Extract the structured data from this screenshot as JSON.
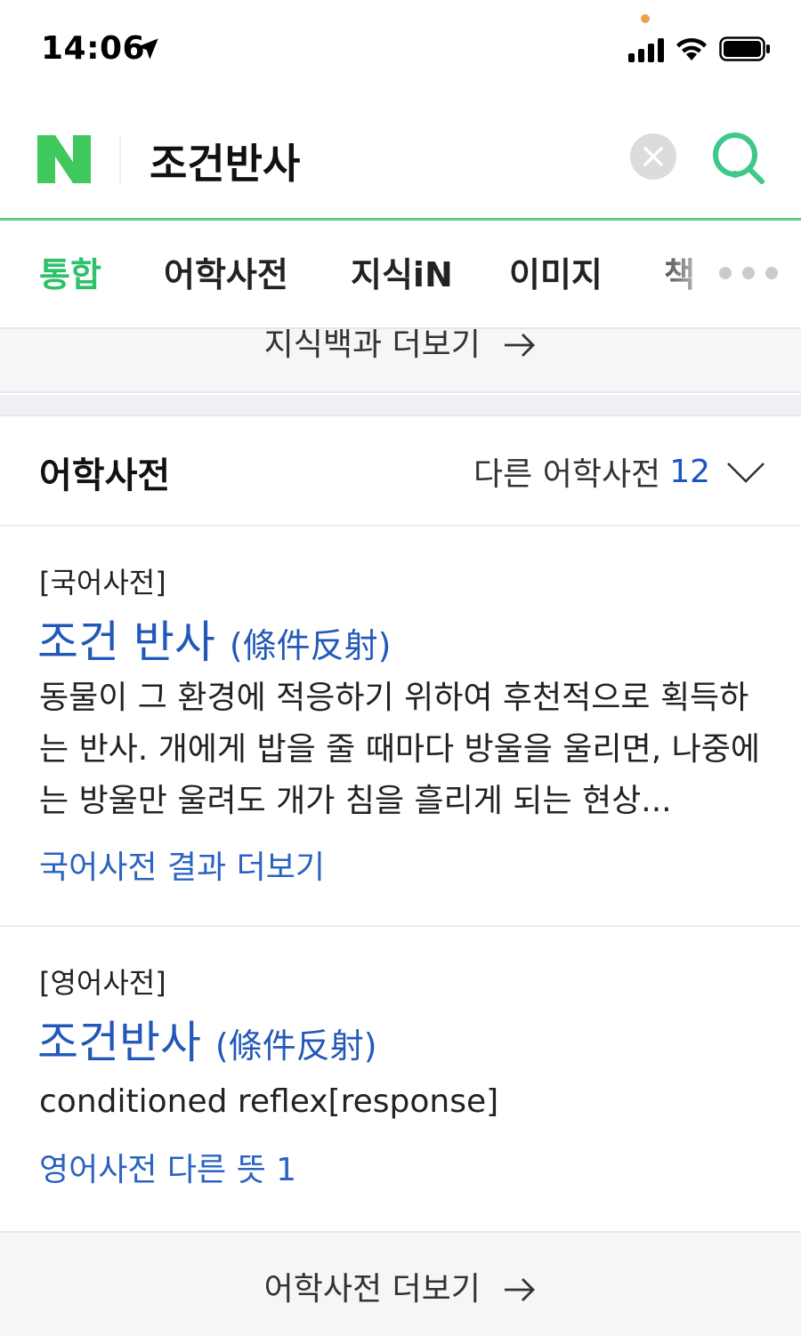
{
  "status_bar": {
    "time": "14:06"
  },
  "search": {
    "query": "조건반사",
    "brand_color": "#03c75a"
  },
  "tabs": [
    {
      "label": "통합",
      "active": true
    },
    {
      "label": "어학사전",
      "active": false
    },
    {
      "label": "지식iN",
      "active": false
    },
    {
      "label": "이미지",
      "active": false
    },
    {
      "label": "책",
      "active": false
    }
  ],
  "prev_section": {
    "more_label": "지식백과 더보기"
  },
  "dictionary": {
    "title": "어학사전",
    "other_label": "다른 어학사전",
    "other_count": "12",
    "entries": [
      {
        "tag": "[국어사전]",
        "headword": "조건 반사",
        "hanja": "(條件反射)",
        "definition": "동물이 그 환경에 적응하기 위하여 후천적으로 획득하는 반사. 개에게 밥을 줄 때마다 방울을 울리면, 나중에는 방울만 울려도 개가 침을 흘리게 되는 현상...",
        "link": "국어사전 결과 더보기"
      },
      {
        "tag": "[영어사전]",
        "headword": "조건반사",
        "hanja": "(條件反射)",
        "definition": "conditioned reflex[response]",
        "link": "영어사전 다른 뜻 1"
      }
    ],
    "more_label": "어학사전 더보기"
  },
  "icons": {
    "location": "location-arrow-icon",
    "signal": "signal-icon",
    "wifi": "wifi-icon",
    "battery": "battery-icon",
    "logo": "naver-logo",
    "clear": "close-icon",
    "search": "search-icon",
    "more": "more-dots-icon",
    "chevron": "chevron-down-icon",
    "arrow": "arrow-right-icon"
  },
  "colors": {
    "accent": "#03c75a",
    "link": "#1b56c2"
  }
}
